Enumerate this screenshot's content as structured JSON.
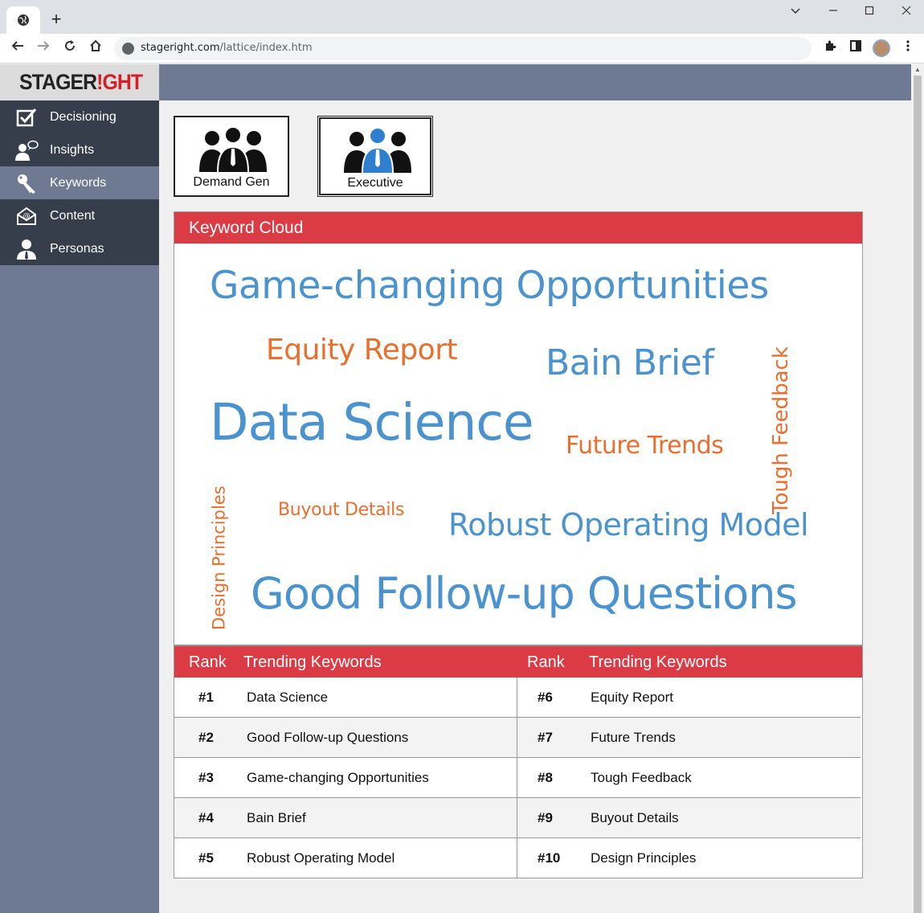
{
  "browser": {
    "url_host": "stageright.com",
    "url_path": "/lattice/index.htm"
  },
  "app": {
    "logo_part1": "STAGER",
    "logo_part2": "!GHT"
  },
  "sidebar": {
    "items": [
      {
        "label": "Decisioning",
        "icon": "checkbox-icon"
      },
      {
        "label": "Insights",
        "icon": "person-speech-icon"
      },
      {
        "label": "Keywords",
        "icon": "key-icon",
        "active": true
      },
      {
        "label": "Content",
        "icon": "email-envelope-icon"
      },
      {
        "label": "Personas",
        "icon": "person-tie-icon"
      }
    ]
  },
  "personas": {
    "demand_gen": "Demand Gen",
    "executive": "Executive",
    "selected": "Executive"
  },
  "cloud": {
    "title": "Keyword Cloud",
    "words": {
      "w1": "Game-changing Opportunities",
      "w2": "Equity Report",
      "w3": "Bain Brief",
      "w4": "Tough Feedback",
      "w5": "Data Science",
      "w6": "Future Trends",
      "w7": "Design Principles",
      "w8": "Buyout Details",
      "w9": "Robust Operating Model",
      "w10": "Good Follow-up Questions"
    }
  },
  "trending": {
    "rank_header": "Rank",
    "keywords_header": "Trending Keywords",
    "left": [
      {
        "rank": "#1",
        "keyword": "Data Science"
      },
      {
        "rank": "#2",
        "keyword": "Good Follow-up Questions"
      },
      {
        "rank": "#3",
        "keyword": "Game-changing Opportunities"
      },
      {
        "rank": "#4",
        "keyword": "Bain Brief"
      },
      {
        "rank": "#5",
        "keyword": "Robust Operating Model"
      }
    ],
    "right": [
      {
        "rank": "#6",
        "keyword": "Equity Report"
      },
      {
        "rank": "#7",
        "keyword": "Future Trends"
      },
      {
        "rank": "#8",
        "keyword": "Tough Feedback"
      },
      {
        "rank": "#9",
        "keyword": "Buyout Details"
      },
      {
        "rank": "#10",
        "keyword": "Design Principles"
      }
    ]
  },
  "colors": {
    "accent_red": "#da3b45",
    "cloud_blue": "#4b93ce",
    "cloud_orange": "#ea6e2d",
    "sidebar_dark": "#363e4c",
    "sidebar_slate": "#6d7a91"
  }
}
